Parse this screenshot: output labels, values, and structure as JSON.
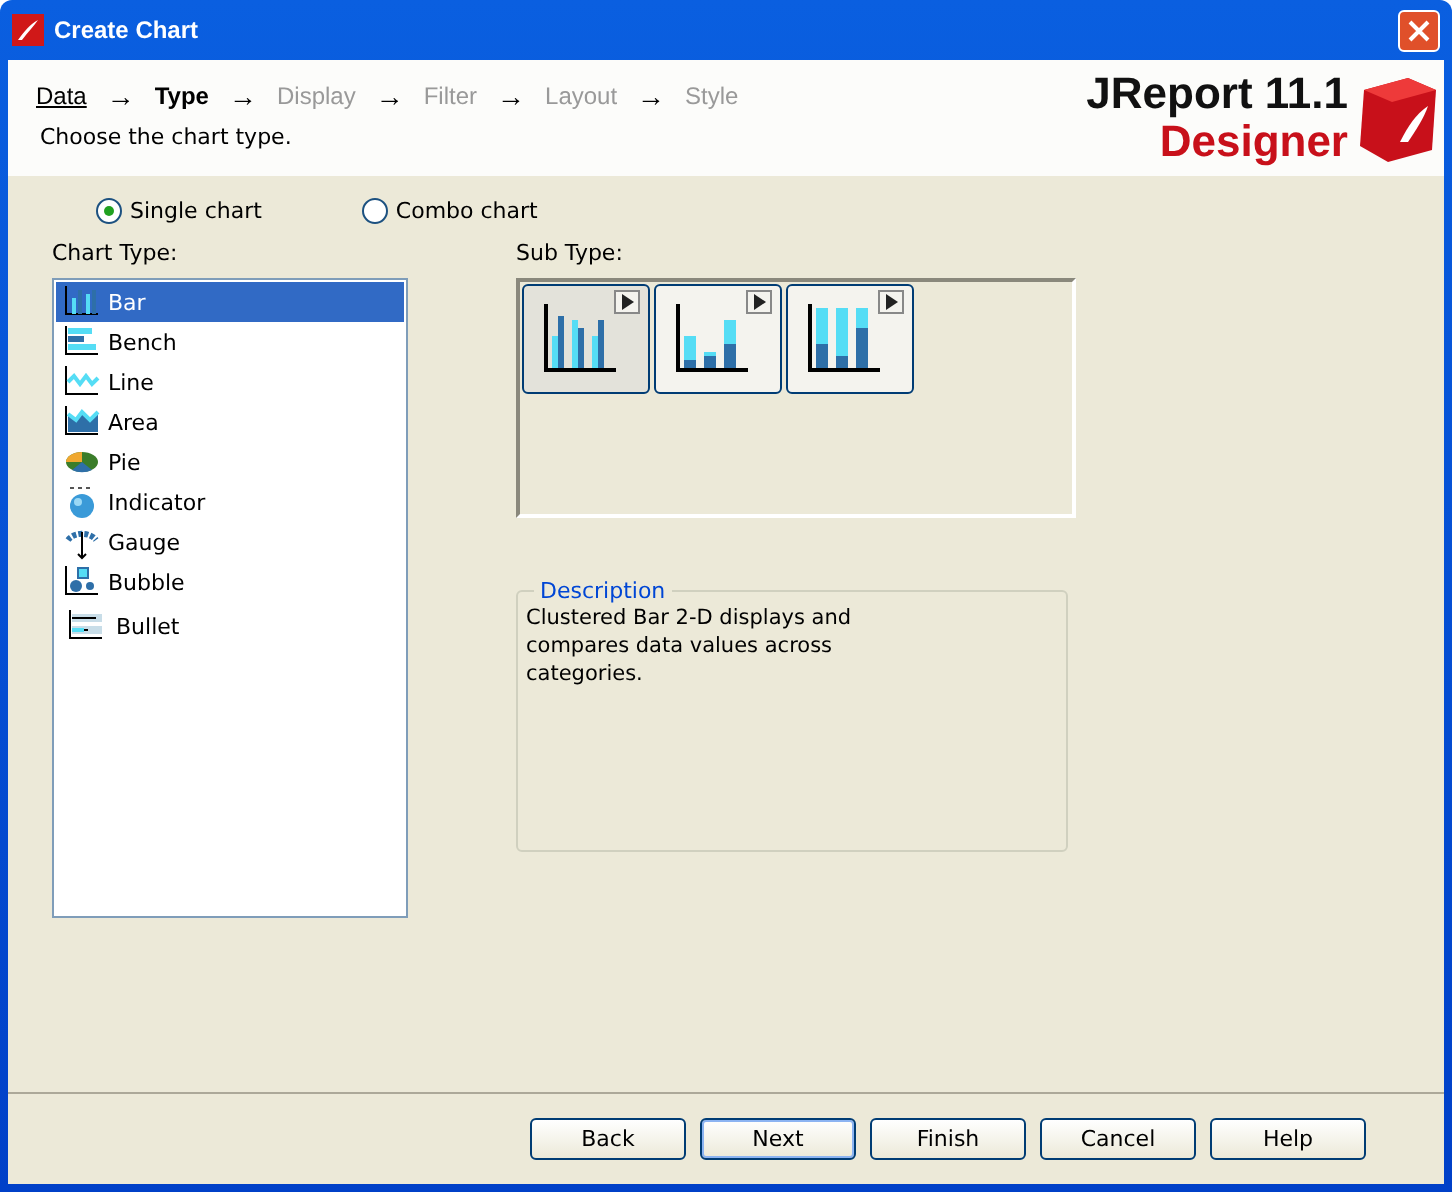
{
  "window": {
    "title": "Create Chart"
  },
  "steps": [
    {
      "label": "Data",
      "completed": true,
      "selected": false,
      "arrow": "→"
    },
    {
      "label": "Type",
      "completed": false,
      "selected": true,
      "arrow": "→"
    },
    {
      "label": "Display",
      "completed": false,
      "selected": false,
      "arrow": "→"
    },
    {
      "label": "Filter",
      "completed": false,
      "selected": false,
      "arrow": "→"
    },
    {
      "label": "Layout",
      "completed": false,
      "selected": false,
      "arrow": "→"
    },
    {
      "label": "Style",
      "completed": false,
      "selected": false
    }
  ],
  "instruction": "Choose the chart type.",
  "logo": {
    "product": "JReport 11.1",
    "edition": "Designer"
  },
  "chart_modes": [
    {
      "label": "Single chart",
      "selected": true
    },
    {
      "label": "Combo chart",
      "selected": false
    }
  ],
  "chart_type": {
    "label": "Chart Type:",
    "items": [
      {
        "label": "Bar",
        "kind": "bar",
        "selected": true
      },
      {
        "label": "Bench",
        "kind": "bench",
        "selected": false
      },
      {
        "label": "Line",
        "kind": "line",
        "selected": false
      },
      {
        "label": "Area",
        "kind": "area",
        "selected": false
      },
      {
        "label": "Pie",
        "kind": "pie",
        "selected": false
      },
      {
        "label": "Indicator",
        "kind": "indicator",
        "selected": false
      },
      {
        "label": "Gauge",
        "kind": "gauge",
        "selected": false
      },
      {
        "label": "Bubble",
        "kind": "bubble",
        "selected": false
      },
      {
        "label": "Bullet",
        "kind": "bullet",
        "selected": false
      }
    ]
  },
  "sub_type": {
    "label": "Sub Type:",
    "items": [
      {
        "kind": "clustered",
        "selected": true
      },
      {
        "kind": "stacked",
        "selected": false
      },
      {
        "kind": "percent",
        "selected": false
      }
    ]
  },
  "description": {
    "legend": "Description",
    "text": "Clustered Bar 2-D displays and compares data values across categories."
  },
  "buttons": [
    {
      "label": "Back",
      "default": false
    },
    {
      "label": "Next",
      "default": true
    },
    {
      "label": "Finish",
      "default": false
    },
    {
      "label": "Cancel",
      "default": false
    },
    {
      "label": "Help",
      "default": false
    }
  ]
}
